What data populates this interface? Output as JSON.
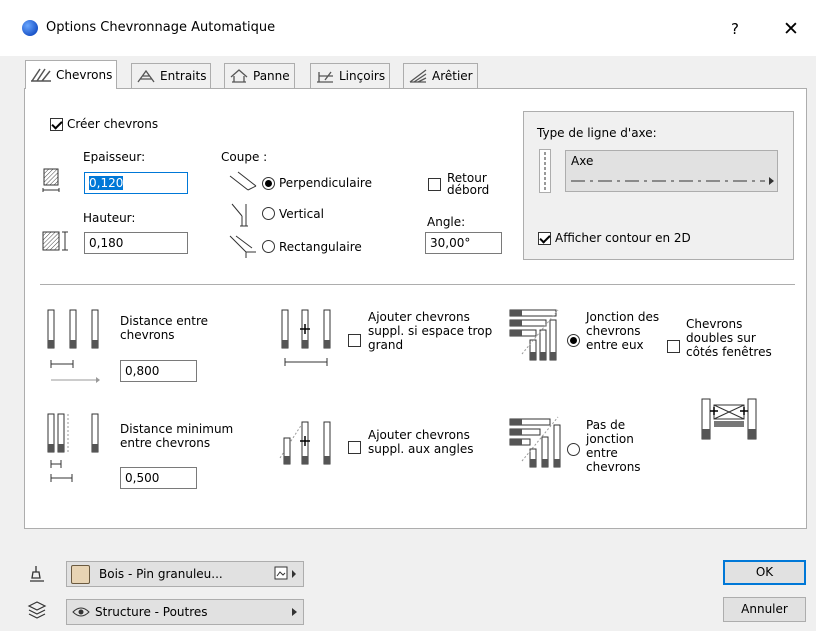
{
  "window": {
    "title": "Options Chevronnage Automatique",
    "help_label": "?",
    "close_label": "✕"
  },
  "tabs": [
    {
      "label": "Chevrons",
      "active": true
    },
    {
      "label": "Entraits",
      "active": false
    },
    {
      "label": "Panne",
      "active": false
    },
    {
      "label": "Linçoirs",
      "active": false
    },
    {
      "label": "Arêtier",
      "active": false
    }
  ],
  "chevrons": {
    "create_label": "Créer chevrons",
    "create_checked": true,
    "epaisseur_label": "Epaisseur:",
    "epaisseur_value": "0,120",
    "hauteur_label": "Hauteur:",
    "hauteur_value": "0,180",
    "coupe_label": "Coupe :",
    "coupe_options": [
      "Perpendiculaire",
      "Vertical",
      "Rectangulaire"
    ],
    "coupe_selected": "Perpendiculaire",
    "retour_debord_label": "Retour débord",
    "retour_debord_checked": false,
    "angle_label": "Angle:",
    "angle_value": "30,00°"
  },
  "axis": {
    "group_label": "Type de ligne d'axe:",
    "line_type": "Axe",
    "show_contour_label": "Afficher contour en 2D",
    "show_contour_checked": true
  },
  "spacing": {
    "distance_label": "Distance entre chevrons",
    "distance_value": "0,800",
    "min_distance_label": "Distance minimum entre chevrons",
    "min_distance_value": "0,500",
    "add_extra_label": "Ajouter chevrons suppl. si espace trop grand",
    "add_extra_checked": false,
    "add_corners_label": "Ajouter chevrons suppl. aux angles",
    "add_corners_checked": false,
    "junction_label": "Jonction des chevrons entre eux",
    "no_junction_label": "Pas de jonction entre chevrons",
    "junction_selected": "Jonction des chevrons entre eux",
    "double_label": "Chevrons doubles sur côtés fenêtres",
    "double_checked": false
  },
  "footer": {
    "material": "Bois - Pin granuleu...",
    "material_color": "#e8d4b4",
    "layer": "Structure - Poutres",
    "ok_label": "OK",
    "cancel_label": "Annuler"
  }
}
